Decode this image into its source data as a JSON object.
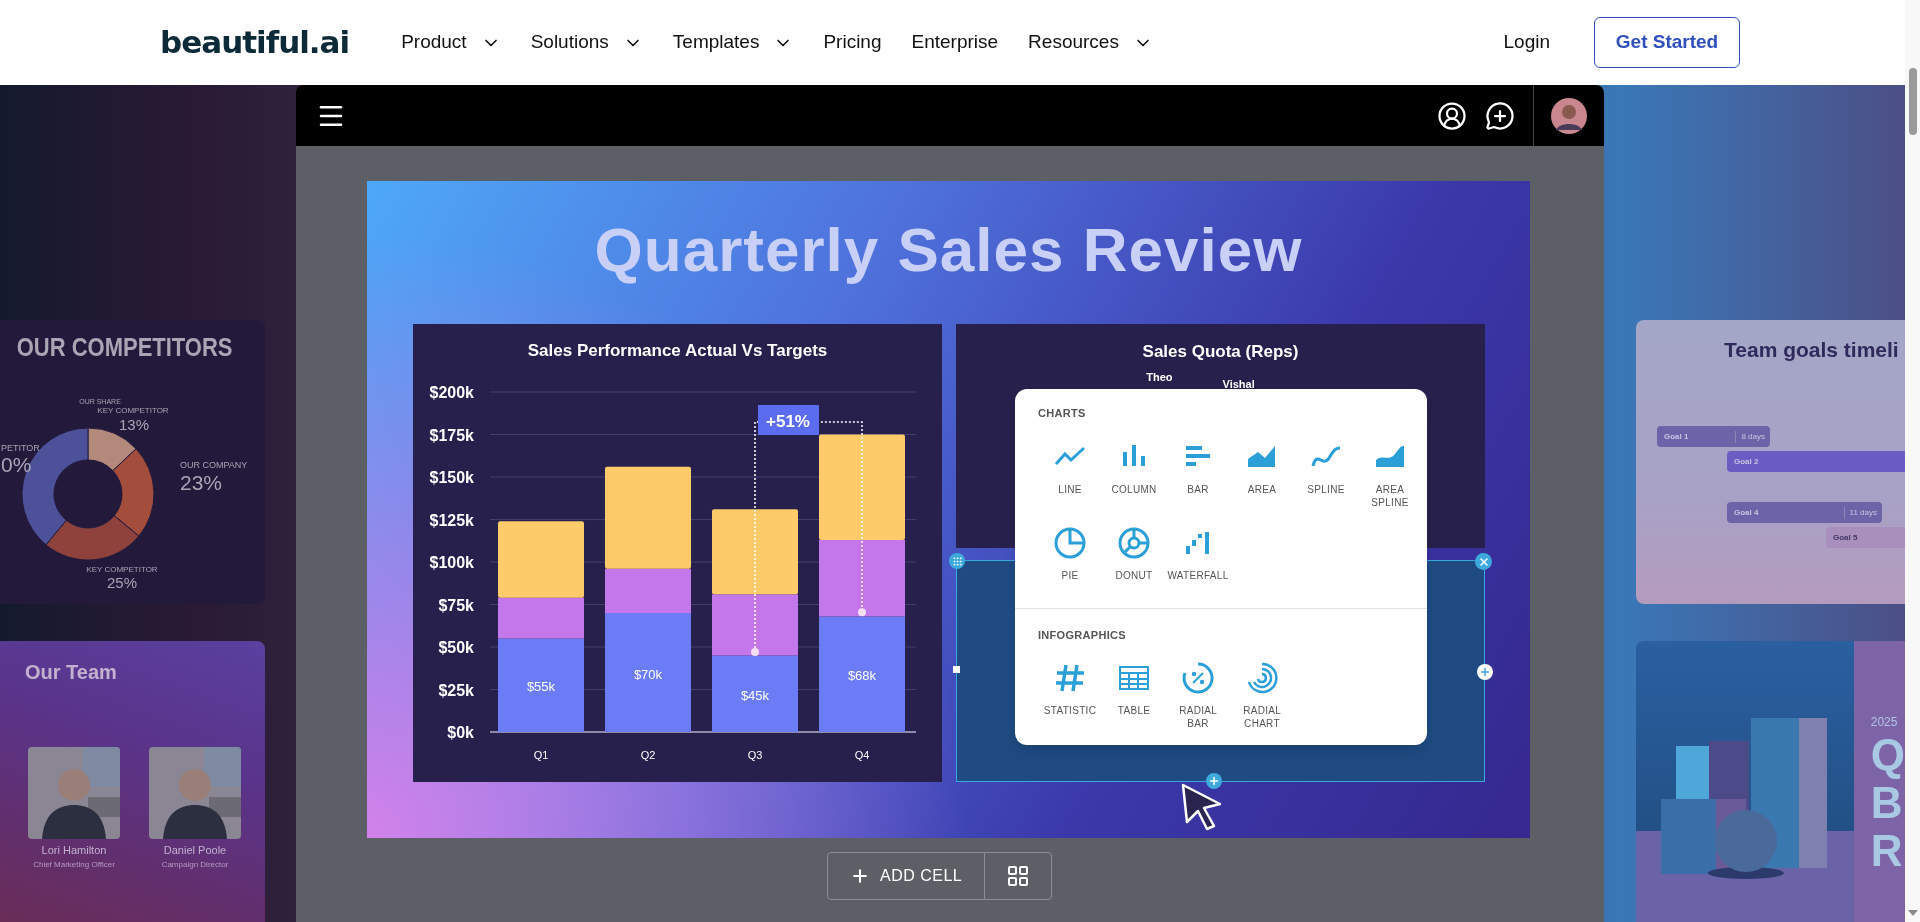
{
  "nav": {
    "logo": "beautiful.ai",
    "items": [
      {
        "label": "Product",
        "dropdown": true
      },
      {
        "label": "Solutions",
        "dropdown": true
      },
      {
        "label": "Templates",
        "dropdown": true
      },
      {
        "label": "Pricing",
        "dropdown": false
      },
      {
        "label": "Enterprise",
        "dropdown": false
      },
      {
        "label": "Resources",
        "dropdown": true
      }
    ],
    "login": "Login",
    "cta": "Get Started"
  },
  "competitors_card": {
    "title": "OUR COMPETITORS",
    "share_label": "OUR SHARE",
    "chart_data": {
      "type": "donut",
      "categories": [
        "KEY COMPETITOR",
        "OUR COMPANY",
        "KEY COMPETITOR",
        "PETITOR"
      ],
      "values": [
        13,
        23,
        25,
        39
      ]
    },
    "percent_labels": [
      "13%",
      "23%",
      "25%",
      "0%"
    ]
  },
  "team_card": {
    "title": "Our Team",
    "members": [
      {
        "name": "Lori Hamilton",
        "role": "Chief Marketing Officer"
      },
      {
        "name": "Daniel Poole",
        "role": "Campaign Director"
      }
    ]
  },
  "slide": {
    "title": "Quarterly Sales Review",
    "chart_panel": {
      "chart_data": {
        "type": "bar",
        "title": "Sales Performance Actual Vs Targets",
        "orientation": "vertical",
        "stacked": true,
        "grid": true,
        "categories": [
          "Q1",
          "Q2",
          "Q3",
          "Q4"
        ],
        "ylim": [
          0,
          200
        ],
        "yticks": [
          {
            "value": 0,
            "label": "$0k"
          },
          {
            "value": 25,
            "label": "$25k"
          },
          {
            "value": 50,
            "label": "$50k"
          },
          {
            "value": 75,
            "label": "$75k"
          },
          {
            "value": 100,
            "label": "$100k"
          },
          {
            "value": 125,
            "label": "$125k"
          },
          {
            "value": 150,
            "label": "$150k"
          },
          {
            "value": 175,
            "label": "$175k"
          },
          {
            "value": 200,
            "label": "$200k"
          }
        ],
        "series": [
          {
            "color": "#6b7cf6",
            "values": [
              55,
              70,
              45,
              68
            ]
          },
          {
            "color": "#c477ea",
            "values": [
              24,
              26,
              36,
              45
            ]
          },
          {
            "color": "#fecb6a",
            "values": [
              45,
              60,
              50,
              62
            ]
          }
        ],
        "value_labels": [
          "$55k",
          "$70k",
          "$45k",
          "$68k"
        ],
        "annotations": [
          {
            "text": "+51%"
          }
        ]
      }
    },
    "quota_panel": {
      "title": "Sales Quota (Reps)",
      "labels": [
        "Theo",
        "Vishal"
      ]
    },
    "cell_menu": {
      "sections": [
        {
          "title": "CHARTS",
          "items": [
            {
              "kind": "line",
              "label": "LINE"
            },
            {
              "kind": "column",
              "label": "COLUMN"
            },
            {
              "kind": "bar",
              "label": "BAR"
            },
            {
              "kind": "area",
              "label": "AREA"
            },
            {
              "kind": "spline",
              "label": "SPLINE"
            },
            {
              "kind": "areaspline",
              "label": "AREA SPLINE"
            },
            {
              "kind": "pie",
              "label": "PIE"
            },
            {
              "kind": "donut",
              "label": "DONUT"
            },
            {
              "kind": "waterfall",
              "label": "WATERFALL"
            }
          ]
        },
        {
          "title": "INFOGRAPHICS",
          "items": [
            {
              "kind": "statistic",
              "label": "STATISTIC"
            },
            {
              "kind": "table",
              "label": "TABLE"
            },
            {
              "kind": "radialbar",
              "label": "RADIAL BAR"
            },
            {
              "kind": "radialchart",
              "label": "RADIAL CHART"
            }
          ]
        }
      ]
    }
  },
  "add_cell": {
    "label": "ADD CELL"
  },
  "timeline_card": {
    "title": "Team goals timeli",
    "goals": [
      {
        "label": "Goal 1",
        "duration": "8 days",
        "color": "#6d63a9"
      },
      {
        "label": "Goal 2",
        "color": "#6a5cc2"
      },
      {
        "label": "Goal 4",
        "duration": "11 days",
        "color": "#6d63a9"
      },
      {
        "label": "Goal 5",
        "color": "#a98fbb"
      }
    ]
  },
  "qbr_card": {
    "year": "2025",
    "letters": [
      "Q",
      "B",
      "R"
    ]
  }
}
